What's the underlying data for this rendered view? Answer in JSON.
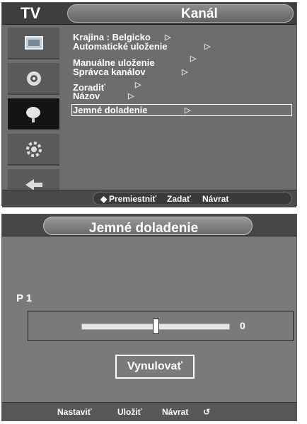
{
  "top_menu": {
    "tv_label": "TV",
    "title": "Kanál",
    "items": [
      {
        "label": "Krajina  : Belgicko",
        "arrow": "▷"
      },
      {
        "label": "Automatické uloženie",
        "arrow": "▷"
      },
      {
        "label": "Manuálne uloženie",
        "arrow": "▷"
      },
      {
        "label": "Správca kanálov",
        "arrow": "▷"
      },
      {
        "label": "Zoradiť",
        "arrow": "▷"
      },
      {
        "label": "Názov",
        "arrow": "▷"
      },
      {
        "label": "Jemné doladenie",
        "arrow": "▷"
      }
    ],
    "selected_index": 6,
    "side_icons": [
      "picture-icon",
      "sound-icon",
      "channel-icon",
      "setup-icon",
      "input-icon"
    ],
    "active_side_icon": 2,
    "footer": {
      "move_icon": "◆",
      "move_label": "Premiestniť",
      "enter_label": "Zadať",
      "return_label": "Návrat",
      "enter_icon": "enter-icon",
      "return_icon": "return-icon"
    }
  },
  "fine_tune": {
    "title": "Jemné doladenie",
    "channel_label": "P 1",
    "slider_value": "0",
    "slider_level": 0.5,
    "reset_label": "Vynulovať",
    "footer": {
      "adjust_label": "Nastaviť",
      "save_label": "Uložiť",
      "return_label": "Návrat",
      "return_glyph": "↺"
    }
  },
  "colors": {
    "panel": "#6d6d6d",
    "panel_light": "#7a7a7a",
    "header": "#3e3e3e",
    "active_icon_bg": "#141414",
    "text": "#ffffff"
  }
}
